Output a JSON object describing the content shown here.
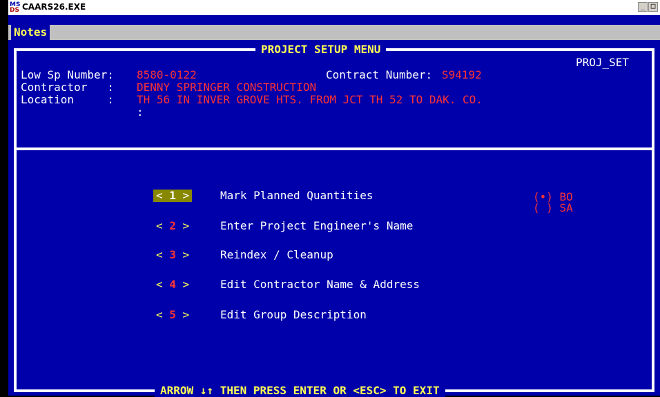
{
  "window": {
    "title": "CAARS26.EXE",
    "icon": "ms-dos-icon",
    "minimize": "minimize-icon",
    "restore": "restore-icon"
  },
  "menu": {
    "notes": "Notes"
  },
  "screen": {
    "title": "PROJECT SETUP MENU",
    "screen_id": "PROJ_SET",
    "low_sp_label": "Low Sp Number:",
    "low_sp_value": "8580-0122",
    "contract_label": "Contract Number:",
    "contract_value": "S94192",
    "contractor_label": "Contractor   :",
    "contractor_value": "DENNY SPRINGER CONSTRUCTION",
    "location_label": "Location     :",
    "location_value": "TH 56 IN INVER GROVE HTS. FROM JCT TH 52 TO DAK. CO.",
    "location_line2": ":",
    "footer": "ARROW ↓↑ THEN PRESS ENTER OR <ESC> TO EXIT"
  },
  "options": [
    {
      "key": "1",
      "label": "Mark Planned Quantities",
      "selected": true
    },
    {
      "key": "2",
      "label": "Enter Project Engineer's Name",
      "selected": false
    },
    {
      "key": "3",
      "label": "Reindex / Cleanup",
      "selected": false
    },
    {
      "key": "4",
      "label": "Edit Contractor Name & Address",
      "selected": false
    },
    {
      "key": "5",
      "label": "Edit Group Description",
      "selected": false
    }
  ],
  "radio": [
    {
      "mark": "(•)",
      "label": "BO",
      "checked": true
    },
    {
      "mark": "( )",
      "label": "SA",
      "checked": false
    }
  ]
}
